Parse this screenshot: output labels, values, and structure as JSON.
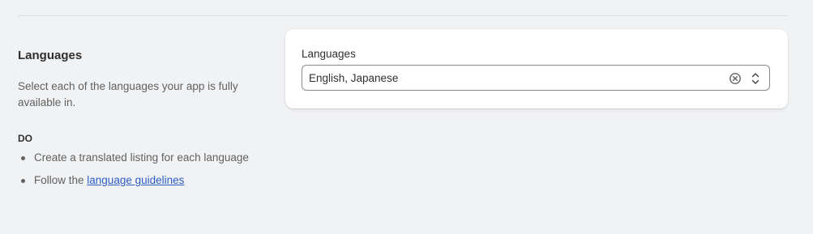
{
  "languages_section": {
    "title": "Languages",
    "description": "Select each of the languages your app is fully available in.",
    "do_heading": "DO",
    "do_items": [
      {
        "text": "Create a translated listing for each language"
      },
      {
        "prefix": "Follow the ",
        "link_text": "language guidelines"
      }
    ]
  },
  "languages_field": {
    "label": "Languages",
    "value": "English, Japanese",
    "icons": [
      "clear-circle-icon",
      "chevron-up-down-icon"
    ]
  },
  "colors": {
    "background": "#f1f2f4",
    "card": "#ffffff",
    "link": "#2c5cc5",
    "muted_text": "#616161"
  }
}
